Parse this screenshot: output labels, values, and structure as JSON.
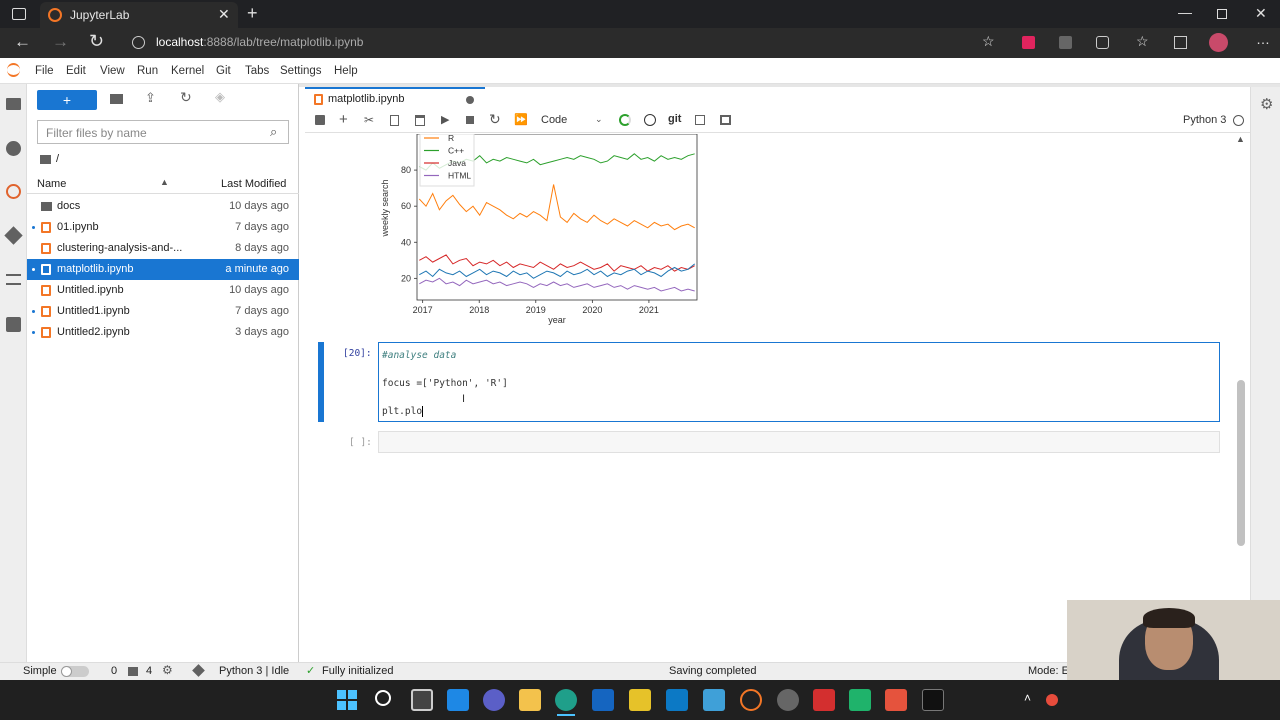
{
  "browser": {
    "tab_title": "JupyterLab",
    "url_host": "localhost",
    "url_rest": ":8888/lab/tree/matplotlib.ipynb"
  },
  "menubar": {
    "items": [
      "File",
      "Edit",
      "View",
      "Run",
      "Kernel",
      "Git",
      "Tabs",
      "Settings",
      "Help"
    ]
  },
  "filebrowser": {
    "new_label": "+",
    "filter_placeholder": "Filter files by name",
    "path": "/",
    "col_name": "Name",
    "col_modified": "Last Modified",
    "files": [
      {
        "name": "docs",
        "modified": "10 days ago"
      },
      {
        "name": "01.ipynb",
        "modified": "7 days ago"
      },
      {
        "name": "clustering-analysis-and-...",
        "modified": "8 days ago"
      },
      {
        "name": "matplotlib.ipynb",
        "modified": "a minute ago"
      },
      {
        "name": "Untitled.ipynb",
        "modified": "10 days ago"
      },
      {
        "name": "Untitled1.ipynb",
        "modified": "7 days ago"
      },
      {
        "name": "Untitled2.ipynb",
        "modified": "3 days ago"
      }
    ]
  },
  "notebook": {
    "tab_title": "matplotlib.ipynb",
    "cell_type": "Code",
    "git_label": "git",
    "kernel": "Python 3",
    "cell_prompt": "[20]:",
    "empty_prompt": "[ ]:",
    "code_lines": [
      "#analyse data",
      "focus =['Python', 'R']",
      "plt.plo"
    ]
  },
  "chart_data": {
    "type": "line",
    "ylabel": "weekly search",
    "xlabel": "year",
    "x_ticks": [
      "2017",
      "2018",
      "2019",
      "2020",
      "2021"
    ],
    "y_ticks": [
      "20",
      "40",
      "60",
      "80"
    ],
    "legend": [
      "R",
      "C++",
      "Java",
      "HTML"
    ],
    "colors": {
      "Python": "#1f77b4",
      "R": "#ff7f0e",
      "C++": "#2ca02c",
      "Java": "#d62728",
      "HTML": "#9467bd"
    },
    "series": [
      {
        "color": "#2ca02c",
        "values": [
          82,
          80,
          84,
          81,
          83,
          85,
          84,
          86,
          85,
          88,
          84,
          86,
          85,
          87,
          86,
          85,
          84,
          86,
          83,
          84,
          85,
          86,
          87,
          86,
          88,
          87,
          86,
          84,
          85,
          88,
          87,
          86,
          89,
          86,
          87,
          85,
          88,
          86,
          87,
          86,
          88,
          89
        ]
      },
      {
        "color": "#ff7f0e",
        "values": [
          64,
          60,
          67,
          58,
          63,
          66,
          61,
          57,
          60,
          55,
          62,
          60,
          58,
          55,
          53,
          56,
          54,
          57,
          55,
          52,
          72,
          54,
          51,
          56,
          53,
          51,
          55,
          52,
          50,
          53,
          51,
          49,
          52,
          50,
          48,
          51,
          49,
          50,
          47,
          49,
          50,
          48
        ]
      },
      {
        "color": "#d62728",
        "values": [
          30,
          32,
          29,
          31,
          33,
          28,
          30,
          31,
          27,
          29,
          28,
          30,
          27,
          29,
          26,
          28,
          27,
          26,
          29,
          27,
          25,
          28,
          26,
          27,
          29,
          27,
          25,
          26,
          28,
          24,
          27,
          26,
          25,
          27,
          24,
          26,
          25,
          27,
          24,
          26,
          25,
          27
        ]
      },
      {
        "color": "#1f77b4",
        "values": [
          22,
          24,
          21,
          25,
          23,
          22,
          24,
          21,
          23,
          25,
          22,
          24,
          23,
          21,
          24,
          22,
          23,
          20,
          22,
          24,
          23,
          21,
          24,
          22,
          23,
          25,
          22,
          24,
          21,
          23,
          22,
          24,
          25,
          22,
          24,
          23,
          21,
          24,
          26,
          24,
          25,
          28
        ]
      },
      {
        "color": "#9467bd",
        "values": [
          17,
          19,
          18,
          20,
          17,
          18,
          16,
          19,
          17,
          18,
          19,
          17,
          18,
          16,
          17,
          18,
          17,
          15,
          17,
          16,
          18,
          16,
          17,
          15,
          16,
          17,
          15,
          16,
          17,
          15,
          16,
          14,
          16,
          15,
          14,
          15,
          13,
          14,
          15,
          13,
          14,
          13
        ]
      }
    ]
  },
  "status": {
    "mode_simple": "Simple",
    "count0": "0",
    "count1": "4",
    "kernel_status": "Python 3 | Idle",
    "init": "Fully initialized",
    "saving": "Saving completed",
    "mode": "Mode: E"
  }
}
